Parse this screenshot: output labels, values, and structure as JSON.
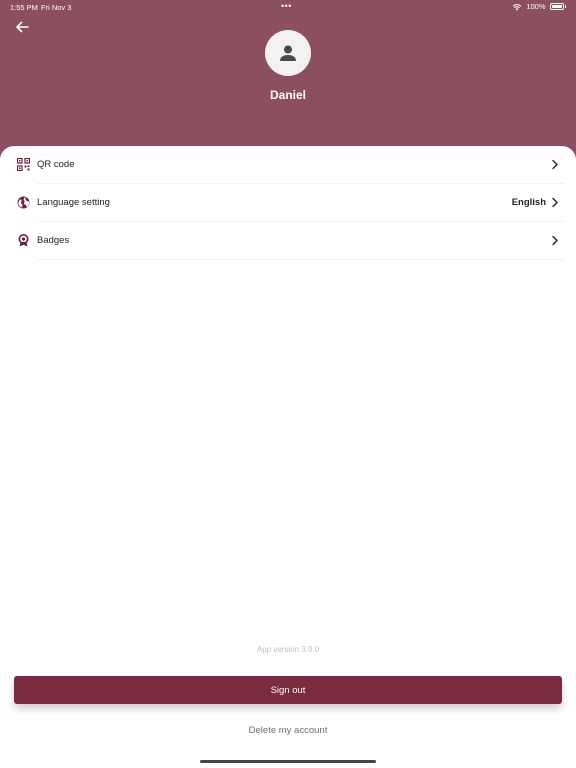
{
  "status_bar": {
    "time": "1:55 PM",
    "date": "Fri Nov 3",
    "dots": "•••",
    "battery": "100%"
  },
  "header": {
    "background": "#8c4f5f",
    "user_name": "Daniel"
  },
  "menu": [
    {
      "label": "QR code",
      "value": "",
      "icon": "qr-code-icon"
    },
    {
      "label": "Language setting",
      "value": "English",
      "icon": "globe-icon"
    },
    {
      "label": "Badges",
      "value": "",
      "icon": "badge-icon"
    }
  ],
  "footer": {
    "app_version": "App version 3.9.0",
    "sign_out_label": "Sign out",
    "delete_account_label": "Delete my account",
    "accent": "#7a2b3e"
  }
}
